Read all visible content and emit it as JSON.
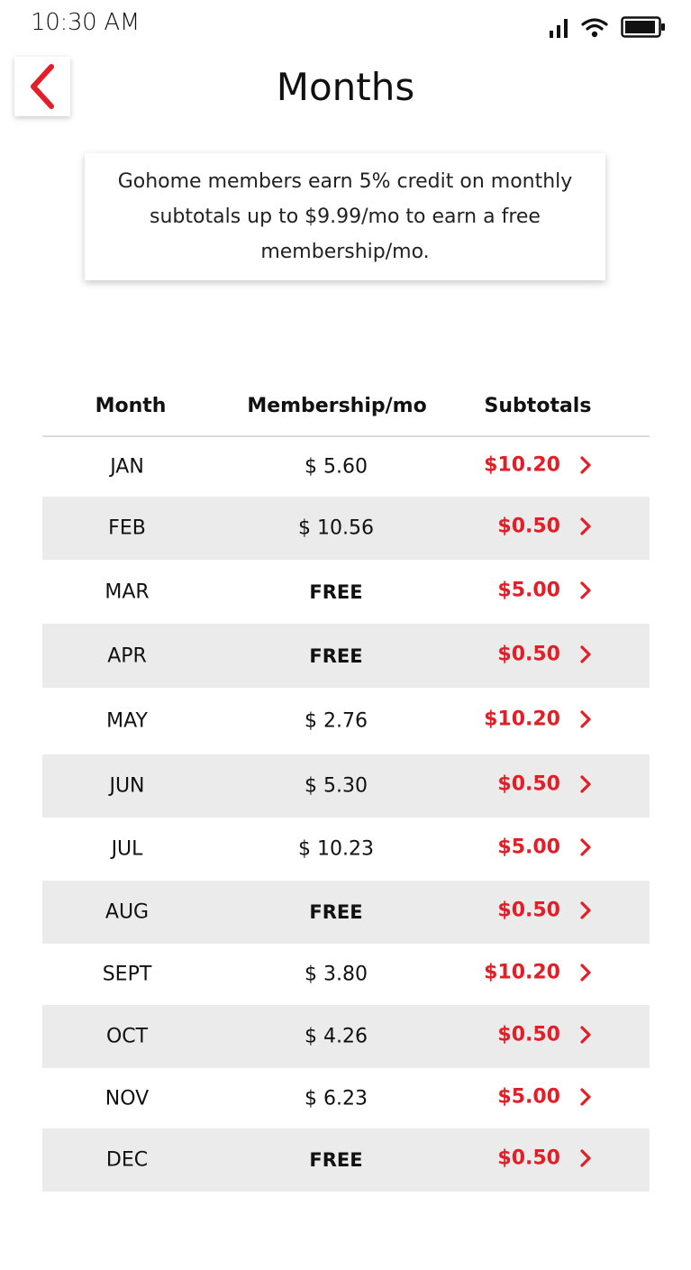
{
  "status_bar": {
    "time": "10:30 AM",
    "icons": [
      "signal-icon",
      "wifi-icon",
      "battery-icon"
    ]
  },
  "header": {
    "title": "Months",
    "back_icon": "chevron-left-icon"
  },
  "info": {
    "text": "Gohome members earn 5% credit on monthly subtotals up to $9.99/mo to earn a free membership/mo."
  },
  "table": {
    "columns": [
      "Month",
      "Membership/mo",
      "Subtotals"
    ],
    "rows": [
      {
        "month": "JAN",
        "membership": "$ 5.60",
        "subtotal": "$10.20"
      },
      {
        "month": "FEB",
        "membership": "$ 10.56",
        "subtotal": "$0.50"
      },
      {
        "month": "MAR",
        "membership": "FREE",
        "subtotal": "$5.00"
      },
      {
        "month": "APR",
        "membership": "FREE",
        "subtotal": "$0.50"
      },
      {
        "month": "MAY",
        "membership": "$ 2.76",
        "subtotal": "$10.20"
      },
      {
        "month": "JUN",
        "membership": "$ 5.30",
        "subtotal": "$0.50"
      },
      {
        "month": "JUL",
        "membership": "$ 10.23",
        "subtotal": "$5.00"
      },
      {
        "month": "AUG",
        "membership": "FREE",
        "subtotal": "$0.50"
      },
      {
        "month": "SEPT",
        "membership": "$ 3.80",
        "subtotal": "$10.20"
      },
      {
        "month": "OCT",
        "membership": "$ 4.26",
        "subtotal": "$0.50"
      },
      {
        "month": "NOV",
        "membership": "$ 6.23",
        "subtotal": "$5.00"
      },
      {
        "month": "DEC",
        "membership": "FREE",
        "subtotal": "$0.50"
      }
    ],
    "row_icon": "chevron-right-icon"
  },
  "colors": {
    "accent": "#e31e26",
    "row_shade": "#ebebeb",
    "text": "#111111",
    "divider": "#dcdcdc"
  }
}
